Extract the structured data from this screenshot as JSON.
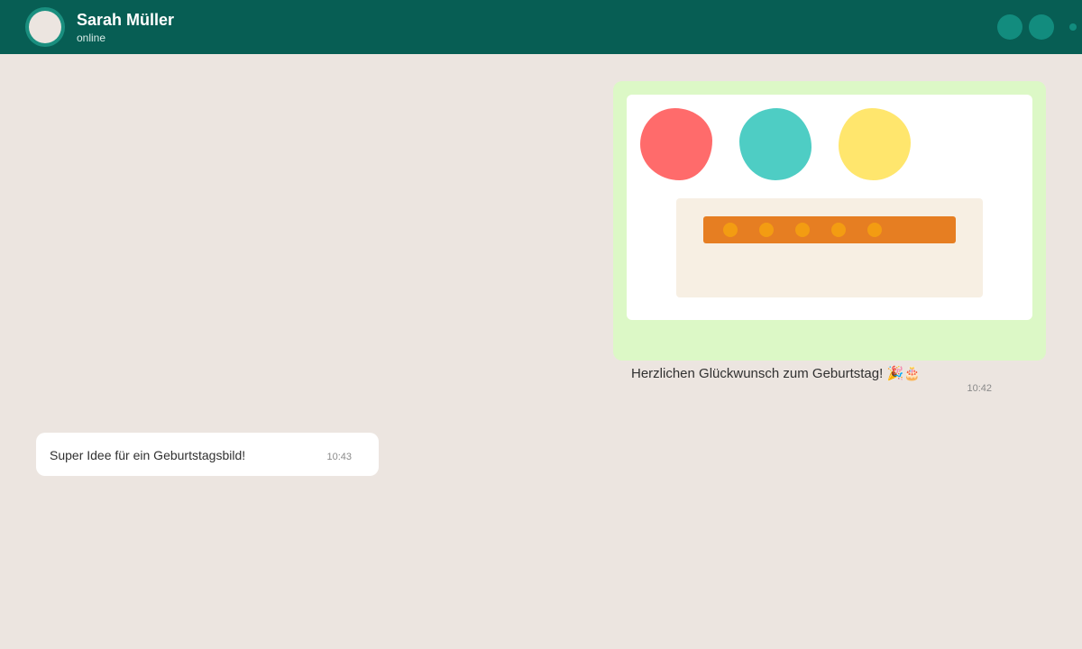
{
  "header": {
    "contact_name": "Sarah Müller",
    "status": "online",
    "avatar_icon": "avatar-icon",
    "call_icon": "phone-icon",
    "video_icon": "video-icon",
    "menu_icon": "more-icon"
  },
  "messages": [
    {
      "direction": "outgoing",
      "type": "image",
      "image": {
        "description_icons": [
          "balloon-icon",
          "balloon-icon",
          "balloon-icon",
          "cake-icon"
        ],
        "balloon_colors": [
          "#ff6b6b",
          "#4ecdc4",
          "#ffe66d"
        ],
        "cake_band_color": "#e67e22",
        "candle_color": "#f39c12",
        "candle_count": 5
      },
      "caption": "Herzlichen Glückwunsch zum Geburtstag! 🎉🎂",
      "time": "10:42"
    },
    {
      "direction": "incoming",
      "type": "text",
      "text": "Super Idee für ein Geburtstagsbild!",
      "time": "10:43"
    }
  ],
  "colors": {
    "header": "#075e54",
    "accent": "#128c7e",
    "chat_background": "#ece5e0",
    "outgoing_bubble": "#dcf8c6",
    "incoming_bubble": "#ffffff"
  }
}
